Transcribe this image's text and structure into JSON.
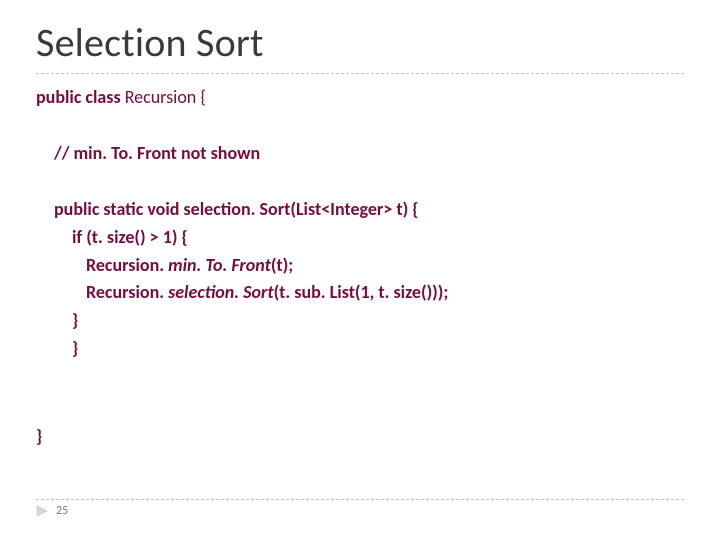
{
  "title": "Selection Sort",
  "code": {
    "line1_kw": "public class",
    "line1_rest": " Recursion {",
    "comment": "// min. To. Front not shown",
    "sig_pre": "public static void ",
    "sig_mid": "selection. Sort(List<Integer> t) {",
    "if_kw": "if",
    "if_rest": " (t. size() > 1) {",
    "call1_a": "Recursion. ",
    "call1_b": "min. To. Front",
    "call1_c": "(t);",
    "call2_a": "Recursion. ",
    "call2_b": "selection. Sort",
    "call2_c": "(t. sub. List(1, t. size()));",
    "close_inner": "}",
    "close_method": "}",
    "close_class": "}"
  },
  "page_number": "25"
}
